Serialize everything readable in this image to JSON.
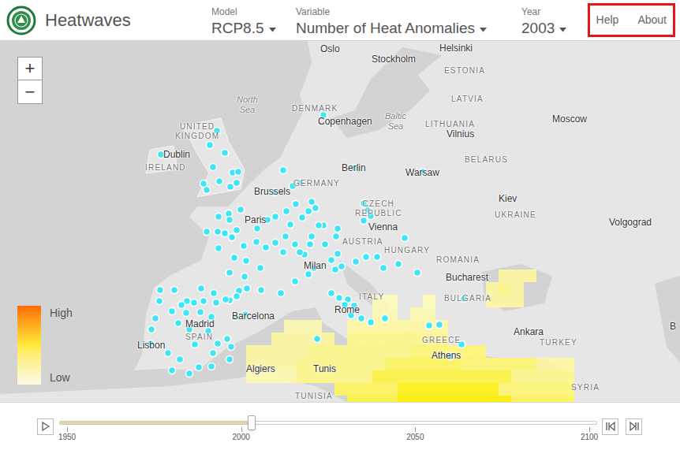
{
  "app": {
    "title": "Heatwaves"
  },
  "selectors": [
    {
      "label": "Model",
      "value": "RCP8.5"
    },
    {
      "label": "Variable",
      "value": "Number of Heat Anomalies"
    },
    {
      "label": "Year",
      "value": "2003"
    }
  ],
  "nav": {
    "highlighted": true,
    "items": [
      {
        "label": "Help"
      },
      {
        "label": "About"
      }
    ]
  },
  "zoom": [
    "+",
    "−"
  ],
  "legend": {
    "high": "High",
    "low": "Low"
  },
  "labels": [
    {
      "text": "Oslo",
      "kind": "city"
    },
    {
      "text": "Stockholm",
      "kind": "city"
    },
    {
      "text": "Helsinki",
      "kind": "city"
    },
    {
      "text": "ESTONIA",
      "kind": "country"
    },
    {
      "text": "LATVIA",
      "kind": "country"
    },
    {
      "text": "North Sea",
      "kind": "sea"
    },
    {
      "text": "Baltic Sea",
      "kind": "sea"
    },
    {
      "text": "DENMARK",
      "kind": "country"
    },
    {
      "text": "Copenhagen",
      "kind": "city"
    },
    {
      "text": "LITHUANIA",
      "kind": "country"
    },
    {
      "text": "Vilnius",
      "kind": "city"
    },
    {
      "text": "Moscow",
      "kind": "city"
    },
    {
      "text": "UNITED KINGDOM",
      "kind": "country"
    },
    {
      "text": "IRELAND",
      "kind": "country"
    },
    {
      "text": "Dublin",
      "kind": "city"
    },
    {
      "text": "BELARUS",
      "kind": "country"
    },
    {
      "text": "Berlin",
      "kind": "city"
    },
    {
      "text": "GERMANY",
      "kind": "country"
    },
    {
      "text": "Warsaw",
      "kind": "city"
    },
    {
      "text": "Brussels",
      "kind": "city"
    },
    {
      "text": "Kiev",
      "kind": "city"
    },
    {
      "text": "UKRAINE",
      "kind": "country"
    },
    {
      "text": "Volgograd",
      "kind": "city"
    },
    {
      "text": "Paris",
      "kind": "city"
    },
    {
      "text": "CZECH REPUBLIC",
      "kind": "country"
    },
    {
      "text": "Vienna",
      "kind": "city"
    },
    {
      "text": "AUSTRIA",
      "kind": "country"
    },
    {
      "text": "HUNGARY",
      "kind": "country"
    },
    {
      "text": "ROMANIA",
      "kind": "country"
    },
    {
      "text": "Milan",
      "kind": "city"
    },
    {
      "text": "Bucharest",
      "kind": "city"
    },
    {
      "text": "BULGARIA",
      "kind": "country"
    },
    {
      "text": "ITALY",
      "kind": "country"
    },
    {
      "text": "Rome",
      "kind": "city"
    },
    {
      "text": "Barcelona",
      "kind": "city"
    },
    {
      "text": "Madrid",
      "kind": "city"
    },
    {
      "text": "SPAIN",
      "kind": "country"
    },
    {
      "text": "Lisbon",
      "kind": "city"
    },
    {
      "text": "Ankara",
      "kind": "city"
    },
    {
      "text": "TURKEY",
      "kind": "country"
    },
    {
      "text": "GREECE",
      "kind": "country"
    },
    {
      "text": "Athens",
      "kind": "city"
    },
    {
      "text": "Algiers",
      "kind": "city"
    },
    {
      "text": "Tunis",
      "kind": "city"
    },
    {
      "text": "TUNISIA",
      "kind": "country"
    },
    {
      "text": "SYRIA",
      "kind": "country"
    },
    {
      "text": "B",
      "kind": "city"
    }
  ],
  "heat_grid": [
    [
      0,
      0,
      0,
      0,
      0,
      0,
      0,
      0,
      0,
      0,
      0,
      0,
      0,
      0,
      0,
      0,
      0,
      0,
      0,
      0,
      0.15,
      0.15,
      0.15,
      0,
      0,
      0
    ],
    [
      0,
      0,
      0,
      0,
      0,
      0,
      0,
      0,
      0,
      0,
      0,
      0,
      0,
      0,
      0,
      0,
      0,
      0,
      0,
      0.15,
      0.2,
      0.15,
      0,
      0,
      0,
      0
    ],
    [
      0,
      0,
      0,
      0,
      0,
      0,
      0,
      0,
      0,
      0,
      0.1,
      0.1,
      0,
      0,
      0.1,
      0,
      0,
      0,
      0,
      0.15,
      0.15,
      0.15,
      0,
      0,
      0,
      0
    ],
    [
      0,
      0,
      0,
      0,
      0,
      0,
      0,
      0,
      0,
      0,
      0.12,
      0.12,
      0,
      0.12,
      0.12,
      0,
      0,
      0,
      0,
      0,
      0,
      0,
      0,
      0,
      0,
      0
    ],
    [
      0,
      0,
      0,
      0.12,
      0.12,
      0.12,
      0,
      0,
      0.15,
      0.15,
      0.15,
      0.15,
      0.15,
      0.15,
      0.15,
      0.15,
      0,
      0,
      0,
      0,
      0,
      0,
      0,
      0,
      0,
      0
    ],
    [
      0,
      0,
      0.15,
      0.15,
      0.15,
      0.15,
      0.15,
      0,
      0.2,
      0.2,
      0.2,
      0.2,
      0.2,
      0.2,
      0.2,
      0.2,
      0,
      0,
      0,
      0,
      0,
      0,
      0,
      0,
      0,
      0
    ],
    [
      0.15,
      0.15,
      0.15,
      0.15,
      0.15,
      0.2,
      0.2,
      0.2,
      0.2,
      0.2,
      0.2,
      0.2,
      0.2,
      0.25,
      0.25,
      0.25,
      0.25,
      0.25,
      0.25,
      0,
      0,
      0,
      0,
      0,
      0,
      0
    ],
    [
      0.15,
      0.15,
      0.15,
      0.15,
      0.2,
      0.2,
      0.2,
      0.2,
      0.2,
      0.2,
      0.2,
      0.3,
      0.3,
      0.3,
      0.3,
      0.3,
      0.3,
      0.25,
      0.25,
      0.25,
      0.25,
      0.25,
      0.25,
      0.15,
      0.15,
      0.15
    ],
    [
      0.12,
      0.12,
      0.12,
      0.12,
      0.2,
      0.2,
      0.2,
      0.2,
      0.2,
      0.2,
      0.35,
      0.35,
      0.35,
      0.35,
      0.35,
      0.35,
      0.35,
      0.35,
      0.35,
      0.35,
      0.35,
      0.2,
      0.2,
      0.2,
      0.2,
      0.2
    ],
    [
      0,
      0,
      0,
      0,
      0,
      0,
      0,
      0.3,
      0.3,
      0.3,
      0.3,
      0.3,
      0.45,
      0.45,
      0.45,
      0.45,
      0.45,
      0.45,
      0.45,
      0.45,
      0.25,
      0.25,
      0.25,
      0.25,
      0.25,
      0.25
    ],
    [
      0,
      0,
      0,
      0,
      0,
      0,
      0,
      0,
      0.35,
      0.35,
      0.35,
      0.35,
      0.5,
      0.5,
      0.5,
      0.5,
      0.5,
      0.5,
      0.5,
      0.5,
      0.5,
      0.3,
      0.3,
      0.3,
      0.3,
      0.3
    ]
  ],
  "timeline": {
    "level": 0.3533,
    "ticks": [
      "1950",
      "2000",
      "2050",
      "2100"
    ]
  }
}
